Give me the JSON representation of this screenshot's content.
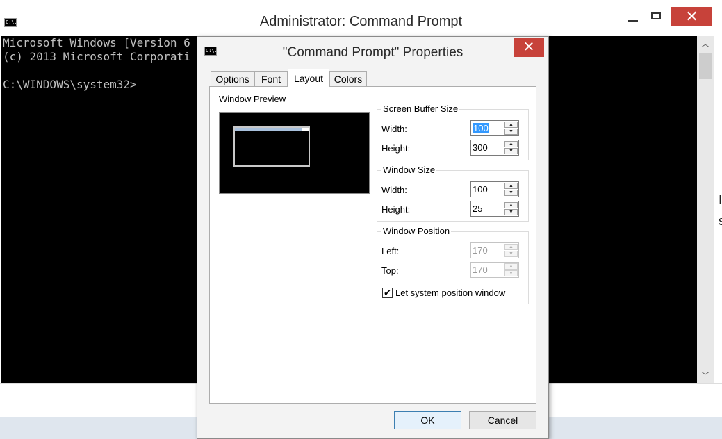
{
  "console_window": {
    "title": "Administrator: Command Prompt",
    "icon_text": "C:\\.",
    "lines": [
      "Microsoft Windows [Version 6",
      "(c) 2013 Microsoft Corporati",
      "",
      "C:\\WINDOWS\\system32>"
    ],
    "minimize_glyph": "—",
    "maximize_glyph": "□",
    "close_glyph": "✕",
    "scroll_up_glyph": "︿",
    "scroll_down_glyph": "﹀",
    "edge_chars": [
      "I",
      "s"
    ]
  },
  "dialog": {
    "title": "\"Command Prompt\" Properties",
    "icon_text": "C:\\.",
    "close_glyph": "✕",
    "tabs": [
      {
        "label": "Options",
        "active": false
      },
      {
        "label": "Font",
        "active": false
      },
      {
        "label": "Layout",
        "active": true
      },
      {
        "label": "Colors",
        "active": false
      }
    ],
    "window_preview_label": "Window Preview",
    "screen_buffer": {
      "title": "Screen Buffer Size",
      "width_label": "Width:",
      "width_value": "100",
      "height_label": "Height:",
      "height_value": "300"
    },
    "window_size": {
      "title": "Window Size",
      "width_label": "Width:",
      "width_value": "100",
      "height_label": "Height:",
      "height_value": "25"
    },
    "window_position": {
      "title": "Window Position",
      "left_label": "Left:",
      "left_value": "170",
      "top_label": "Top:",
      "top_value": "170",
      "checkbox_label": "Let system position window",
      "checkbox_checked": true,
      "check_glyph": "✔"
    },
    "ok_label": "OK",
    "cancel_label": "Cancel",
    "spin_up_glyph": "▲",
    "spin_down_glyph": "▼"
  }
}
